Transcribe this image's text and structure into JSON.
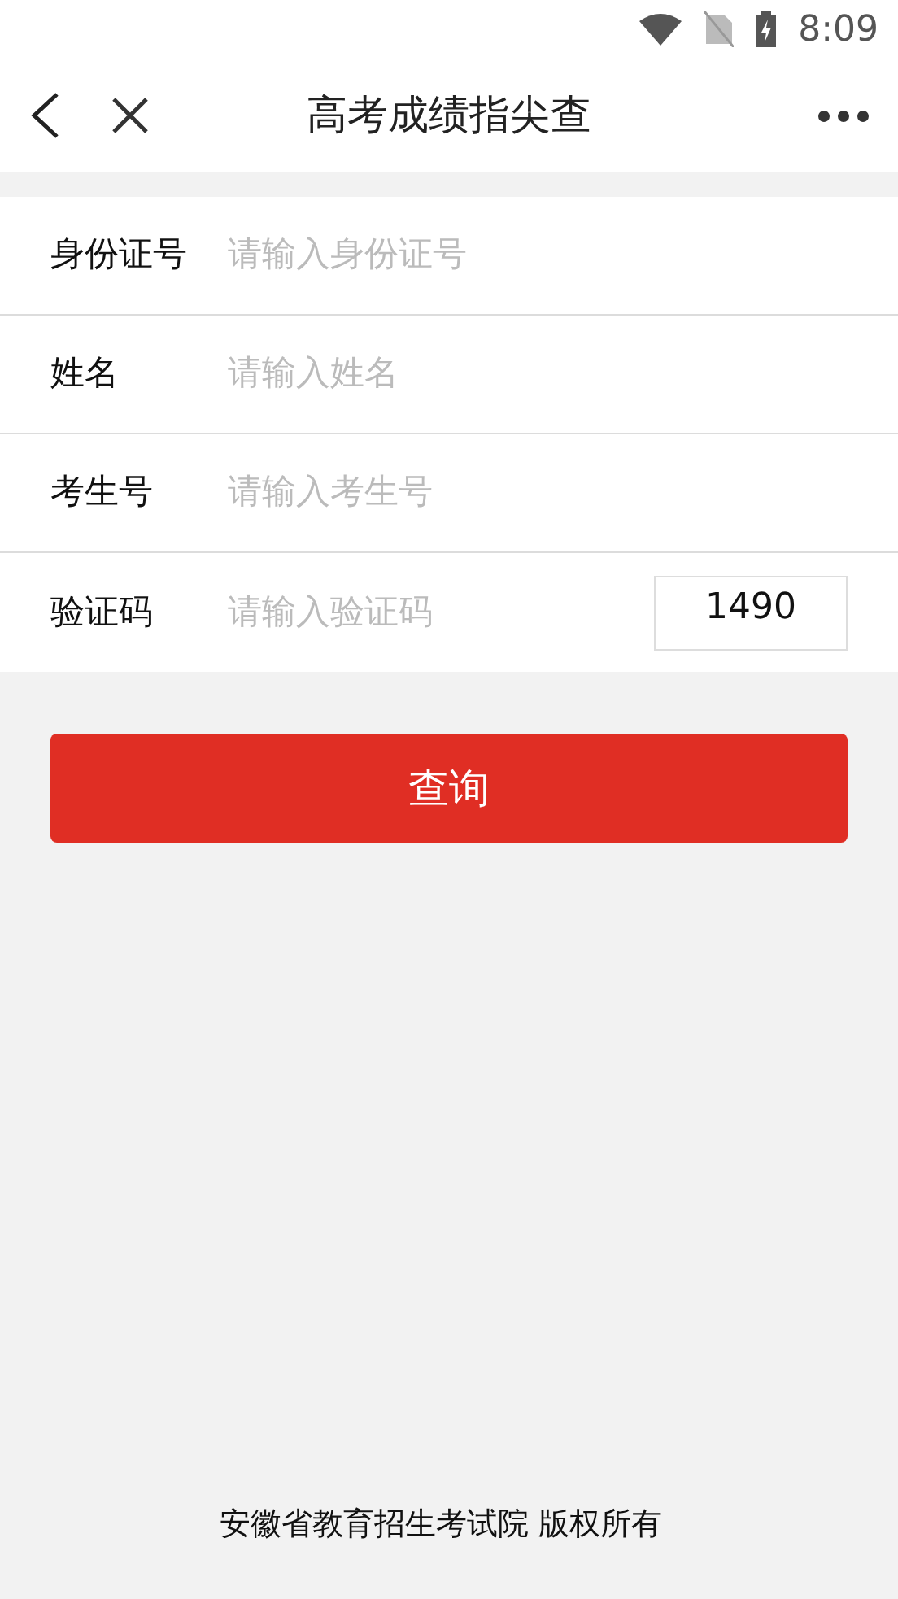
{
  "status_bar": {
    "time": "8:09"
  },
  "header": {
    "title": "高考成绩指尖查"
  },
  "form": {
    "fields": [
      {
        "label": "身份证号",
        "placeholder": "请输入身份证号"
      },
      {
        "label": "姓名",
        "placeholder": "请输入姓名"
      },
      {
        "label": "考生号",
        "placeholder": "请输入考生号"
      },
      {
        "label": "验证码",
        "placeholder": "请输入验证码",
        "captcha": "1490"
      }
    ]
  },
  "submit_button": {
    "label": "查询"
  },
  "footer": {
    "text": "安徽省教育招生考试院 版权所有"
  }
}
